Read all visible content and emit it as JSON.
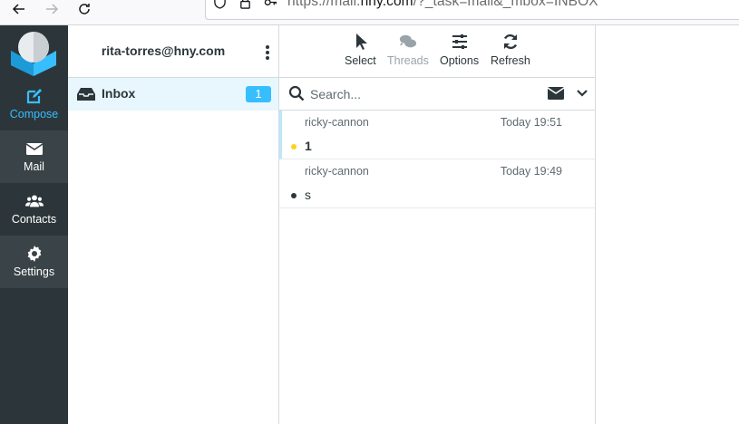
{
  "browser": {
    "url_prefix": "https://mail.",
    "url_domain": "hny.com",
    "url_suffix": "/?_task=mail&_mbox=INBOX"
  },
  "taskmenu": {
    "items": [
      {
        "label": "Compose",
        "icon": "compose-icon"
      },
      {
        "label": "Mail",
        "icon": "envelope-icon"
      },
      {
        "label": "Contacts",
        "icon": "users-icon"
      },
      {
        "label": "Settings",
        "icon": "gear-icon"
      }
    ],
    "accent_color": "#37beff"
  },
  "folders": {
    "username": "rita-torres@hny.com",
    "items": [
      {
        "label": "Inbox",
        "unread_count": "1",
        "icon": "inbox-icon"
      }
    ]
  },
  "toolbar": {
    "buttons": [
      {
        "label": "Select",
        "icon": "pointer-icon",
        "enabled": true
      },
      {
        "label": "Threads",
        "icon": "threads-icon",
        "enabled": false
      },
      {
        "label": "Options",
        "icon": "sliders-icon",
        "enabled": true
      },
      {
        "label": "Refresh",
        "icon": "refresh-icon",
        "enabled": true
      }
    ]
  },
  "search": {
    "placeholder": "Search..."
  },
  "messages": [
    {
      "from": "ricky-cannon",
      "date": "Today 19:51",
      "subject": "1",
      "unread": true,
      "flag_color": "#ffd11a"
    },
    {
      "from": "ricky-cannon",
      "date": "Today 19:49",
      "subject": "s",
      "unread": false,
      "flag_color": "#2c363a"
    }
  ]
}
